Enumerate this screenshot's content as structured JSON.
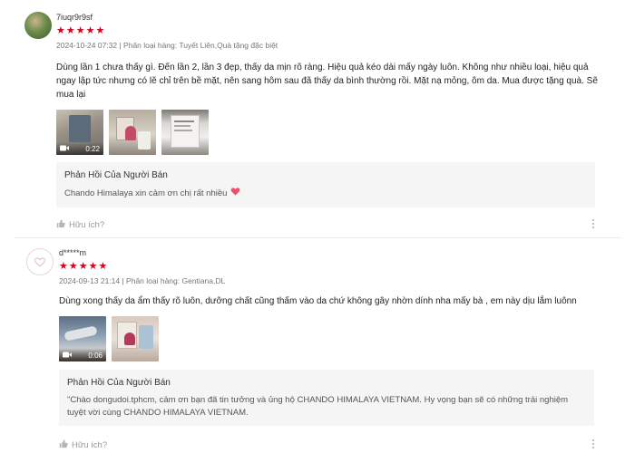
{
  "reviews": [
    {
      "username": "7iuqr9r9sf",
      "rating": 5,
      "meta": "2024-10-24 07:32 | Phân loại hàng: Tuyết Liên,Quà tặng đặc biệt",
      "text": "Dùng lần 1 chưa thấy gì. Đến lần 2, lần 3 đẹp, thấy da mịn rõ ràng. Hiệu quả kéo dài mấy ngày luôn. Không như nhiều loại, hiệu quả ngay lập tức nhưng có lẽ chỉ trên bề mặt, nên sang hôm sau đã thấy da bình thường rồi. Mặt nạ mỏng, ôm da. Mua được tặng quà. Sẽ mua lại",
      "video_duration": "0:22",
      "reply_title": "Phản Hồi Của Người Bán",
      "reply_text": "Chando Himalaya xin cảm ơn chị rất nhiều",
      "helpful": "Hữu ích?"
    },
    {
      "username": "d*****m",
      "rating": 5,
      "meta": "2024-09-13 21:14 | Phân loại hàng: Gentiana,DL",
      "text": "Dùng xong thấy da ẩm thấy rõ luôn, dưỡng chất cũng thấm vào da chứ không gây nhờn dính nha mấy bà , em này dịu lắm luônn",
      "video_duration": "0:06",
      "reply_title": "Phản Hồi Của Người Bán",
      "reply_text": "\"Chào dongudoi.tphcm, cảm ơn bạn đã tin tưởng và ủng hộ CHANDO HIMALAYA VIETNAM. Hy vọng bạn sẽ có những trải nghiệm tuyệt vời cùng CHANDO HIMALAYA VIETNAM.",
      "helpful": "Hữu ích?"
    }
  ],
  "colors": {
    "star": "#d0011b",
    "reply_bg": "#f5f5f5",
    "heart": "#ee4d6b"
  },
  "icons": {
    "star": "star-icon",
    "thumbs_up": "thumbs-up-icon",
    "video": "video-camera-icon",
    "more": "more-vertical-icon",
    "heart": "heart-icon"
  }
}
